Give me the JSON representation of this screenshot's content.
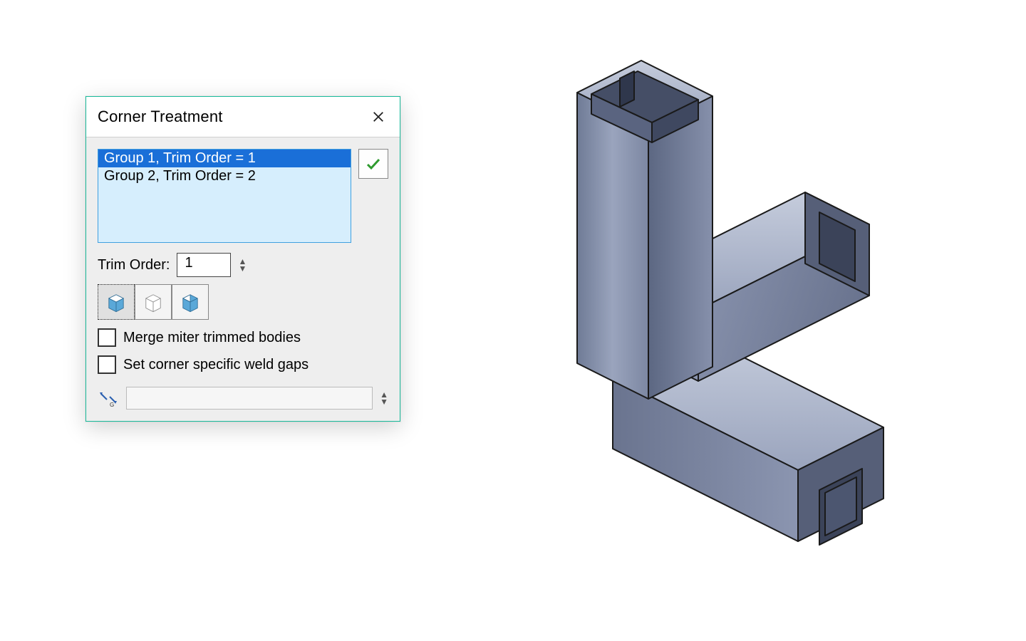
{
  "dialog": {
    "title": "Corner Treatment",
    "groups": [
      {
        "label": "Group 1, Trim Order = 1",
        "selected": true
      },
      {
        "label": "Group 2, Trim Order = 2",
        "selected": false
      }
    ],
    "trimOrderLabel": "Trim Order:",
    "trimOrderValue": "1",
    "mergeLabel": "Merge miter trimmed bodies",
    "mergeChecked": false,
    "weldGapLabel": "Set corner specific weld gaps",
    "weldGapChecked": false,
    "gapValue": ""
  }
}
